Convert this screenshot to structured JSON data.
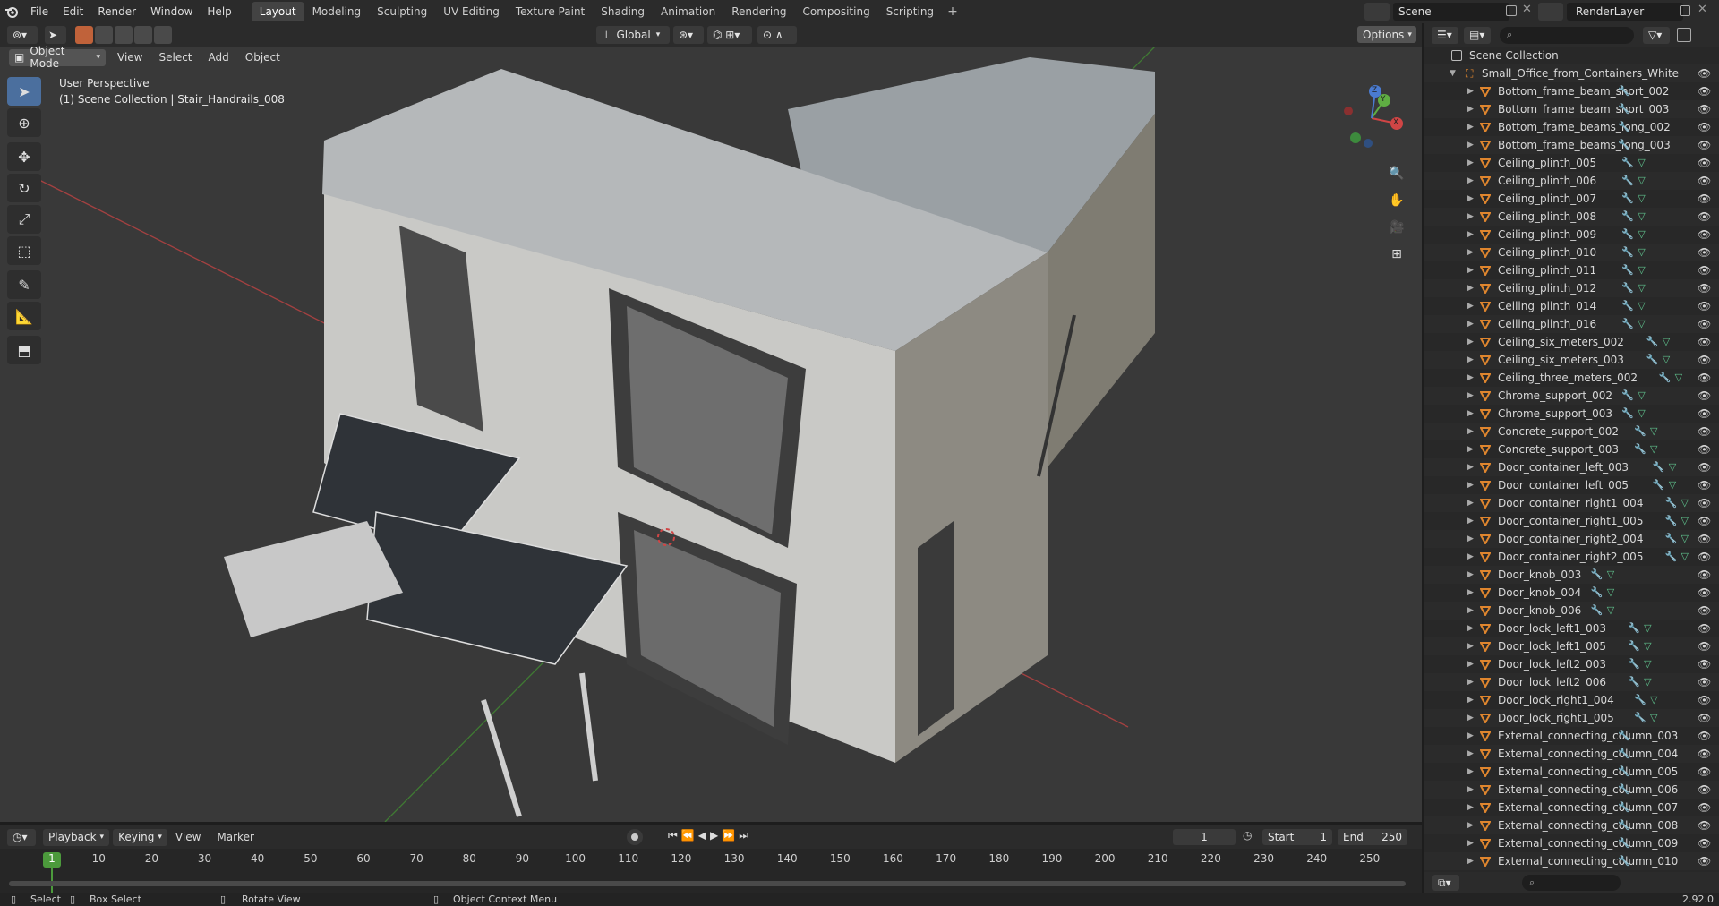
{
  "topbar": {
    "menus": [
      "File",
      "Edit",
      "Render",
      "Window",
      "Help"
    ],
    "workspaces": [
      "Layout",
      "Modeling",
      "Sculpting",
      "UV Editing",
      "Texture Paint",
      "Shading",
      "Animation",
      "Rendering",
      "Compositing",
      "Scripting"
    ],
    "active_workspace": "Layout",
    "add_tab": "+",
    "scene_name": "Scene",
    "view_layer": "RenderLayer"
  },
  "viewport_header": {
    "mode": "Object Mode",
    "menus": [
      "View",
      "Select",
      "Add",
      "Object"
    ],
    "orientation": "Global",
    "options": "Options"
  },
  "viewport": {
    "view_name": "User Perspective",
    "context": "(1) Scene Collection | Stair_Handrails_008",
    "gizmo_axes": {
      "x": "X",
      "y": "Y",
      "z": "Z"
    }
  },
  "toolbar": {
    "tools": [
      "select-box",
      "cursor",
      "move",
      "rotate",
      "scale",
      "transform",
      "annotate",
      "measure",
      "add-cube"
    ]
  },
  "timeline": {
    "menus": [
      "Playback",
      "Keying",
      "View",
      "Marker"
    ],
    "current_frame": "1",
    "start_label": "Start",
    "start": "1",
    "end_label": "End",
    "end": "250",
    "ruler": [
      "10",
      "20",
      "30",
      "40",
      "50",
      "60",
      "70",
      "80",
      "90",
      "100",
      "110",
      "120",
      "130",
      "140",
      "150",
      "160",
      "170",
      "180",
      "190",
      "200",
      "210",
      "220",
      "230",
      "240",
      "250"
    ],
    "cursor_label": "1"
  },
  "statusbar": {
    "select": "Select",
    "box_select": "Box Select",
    "rotate_view": "Rotate View",
    "context_menu": "Object Context Menu",
    "version": "2.92.0"
  },
  "outliner": {
    "root": "Scene Collection",
    "collection": "Small_Office_from_Containers_White",
    "items": [
      {
        "name": "Bottom_frame_beam_short_002",
        "mesh": false
      },
      {
        "name": "Bottom_frame_beam_short_003",
        "mesh": false
      },
      {
        "name": "Bottom_frame_beams_long_002",
        "mesh": false
      },
      {
        "name": "Bottom_frame_beams_long_003",
        "mesh": false
      },
      {
        "name": "Ceiling_plinth_005",
        "mesh": true
      },
      {
        "name": "Ceiling_plinth_006",
        "mesh": true
      },
      {
        "name": "Ceiling_plinth_007",
        "mesh": true
      },
      {
        "name": "Ceiling_plinth_008",
        "mesh": true
      },
      {
        "name": "Ceiling_plinth_009",
        "mesh": true
      },
      {
        "name": "Ceiling_plinth_010",
        "mesh": true
      },
      {
        "name": "Ceiling_plinth_011",
        "mesh": true
      },
      {
        "name": "Ceiling_plinth_012",
        "mesh": true
      },
      {
        "name": "Ceiling_plinth_014",
        "mesh": true
      },
      {
        "name": "Ceiling_plinth_016",
        "mesh": true
      },
      {
        "name": "Ceiling_six_meters_002",
        "mesh": true
      },
      {
        "name": "Ceiling_six_meters_003",
        "mesh": true
      },
      {
        "name": "Ceiling_three_meters_002",
        "mesh": true
      },
      {
        "name": "Chrome_support_002",
        "mesh": true
      },
      {
        "name": "Chrome_support_003",
        "mesh": true
      },
      {
        "name": "Concrete_support_002",
        "mesh": true
      },
      {
        "name": "Concrete_support_003",
        "mesh": true
      },
      {
        "name": "Door_container_left_003",
        "mesh": true
      },
      {
        "name": "Door_container_left_005",
        "mesh": true
      },
      {
        "name": "Door_container_right1_004",
        "mesh": true
      },
      {
        "name": "Door_container_right1_005",
        "mesh": true
      },
      {
        "name": "Door_container_right2_004",
        "mesh": true
      },
      {
        "name": "Door_container_right2_005",
        "mesh": true
      },
      {
        "name": "Door_knob_003",
        "mesh": true
      },
      {
        "name": "Door_knob_004",
        "mesh": true
      },
      {
        "name": "Door_knob_006",
        "mesh": true
      },
      {
        "name": "Door_lock_left1_003",
        "mesh": true
      },
      {
        "name": "Door_lock_left1_005",
        "mesh": true
      },
      {
        "name": "Door_lock_left2_003",
        "mesh": true
      },
      {
        "name": "Door_lock_left2_006",
        "mesh": true
      },
      {
        "name": "Door_lock_right1_004",
        "mesh": true
      },
      {
        "name": "Door_lock_right1_005",
        "mesh": true
      },
      {
        "name": "External_connecting_column_003",
        "mesh": false
      },
      {
        "name": "External_connecting_column_004",
        "mesh": false
      },
      {
        "name": "External_connecting_column_005",
        "mesh": false
      },
      {
        "name": "External_connecting_column_006",
        "mesh": false
      },
      {
        "name": "External_connecting_column_007",
        "mesh": false
      },
      {
        "name": "External_connecting_column_008",
        "mesh": false
      },
      {
        "name": "External_connecting_column_009",
        "mesh": false
      },
      {
        "name": "External_connecting_column_010",
        "mesh": false
      }
    ]
  },
  "colors": {
    "accent_blue": "#4b6f9e",
    "frame_green": "#4c9a3c",
    "object_orange": "#e0862e",
    "axis_red": "#c04545",
    "axis_green": "#4c8a3a"
  }
}
